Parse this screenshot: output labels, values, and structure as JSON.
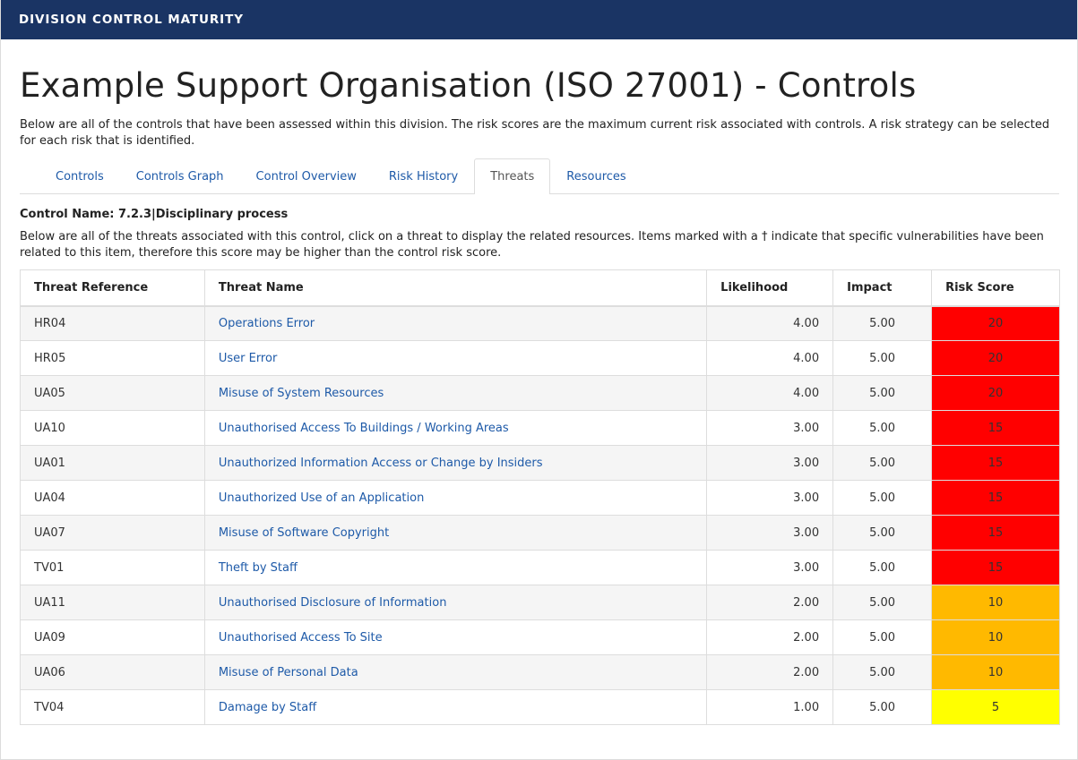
{
  "topbar": {
    "title": "DIVISION CONTROL MATURITY"
  },
  "page": {
    "title": "Example Support Organisation (ISO 27001) - Controls",
    "intro": "Below are all of the controls that have been assessed within this division. The risk scores are the maximum current risk associated with controls. A risk strategy can be selected for each risk that is identified."
  },
  "tabs": [
    {
      "label": "Controls",
      "active": false
    },
    {
      "label": "Controls Graph",
      "active": false
    },
    {
      "label": "Control Overview",
      "active": false
    },
    {
      "label": "Risk History",
      "active": false
    },
    {
      "label": "Threats",
      "active": true
    },
    {
      "label": "Resources",
      "active": false
    }
  ],
  "control": {
    "name_line": "Control Name: 7.2.3|Disciplinary process",
    "description": "Below are all of the threats associated with this control, click on a threat to display the related resources. Items marked with a † indicate that specific vulnerabilities have been related to this item, therefore this score may be higher than the control risk score."
  },
  "table": {
    "headers": {
      "reference": "Threat Reference",
      "name": "Threat Name",
      "likelihood": "Likelihood",
      "impact": "Impact",
      "risk": "Risk Score"
    },
    "rows": [
      {
        "reference": "HR04",
        "name": "Operations Error",
        "likelihood": "4.00",
        "impact": "5.00",
        "risk": "20"
      },
      {
        "reference": "HR05",
        "name": "User Error",
        "likelihood": "4.00",
        "impact": "5.00",
        "risk": "20"
      },
      {
        "reference": "UA05",
        "name": "Misuse of System Resources",
        "likelihood": "4.00",
        "impact": "5.00",
        "risk": "20"
      },
      {
        "reference": "UA10",
        "name": "Unauthorised Access To Buildings / Working Areas",
        "likelihood": "3.00",
        "impact": "5.00",
        "risk": "15"
      },
      {
        "reference": "UA01",
        "name": "Unauthorized Information Access or Change by Insiders",
        "likelihood": "3.00",
        "impact": "5.00",
        "risk": "15"
      },
      {
        "reference": "UA04",
        "name": "Unauthorized Use of an Application",
        "likelihood": "3.00",
        "impact": "5.00",
        "risk": "15"
      },
      {
        "reference": "UA07",
        "name": "Misuse of Software Copyright",
        "likelihood": "3.00",
        "impact": "5.00",
        "risk": "15"
      },
      {
        "reference": "TV01",
        "name": "Theft by Staff",
        "likelihood": "3.00",
        "impact": "5.00",
        "risk": "15"
      },
      {
        "reference": "UA11",
        "name": "Unauthorised Disclosure of Information",
        "likelihood": "2.00",
        "impact": "5.00",
        "risk": "10"
      },
      {
        "reference": "UA09",
        "name": "Unauthorised Access To Site",
        "likelihood": "2.00",
        "impact": "5.00",
        "risk": "10"
      },
      {
        "reference": "UA06",
        "name": "Misuse of Personal Data",
        "likelihood": "2.00",
        "impact": "5.00",
        "risk": "10"
      },
      {
        "reference": "TV04",
        "name": "Damage by Staff",
        "likelihood": "1.00",
        "impact": "5.00",
        "risk": "5"
      }
    ]
  },
  "colors": {
    "header_bg": "#1a3464",
    "link": "#1e5aa8",
    "risk_20": "#ff0000",
    "risk_15": "#ff0000",
    "risk_10": "#ffb900",
    "risk_5": "#ffff00"
  }
}
